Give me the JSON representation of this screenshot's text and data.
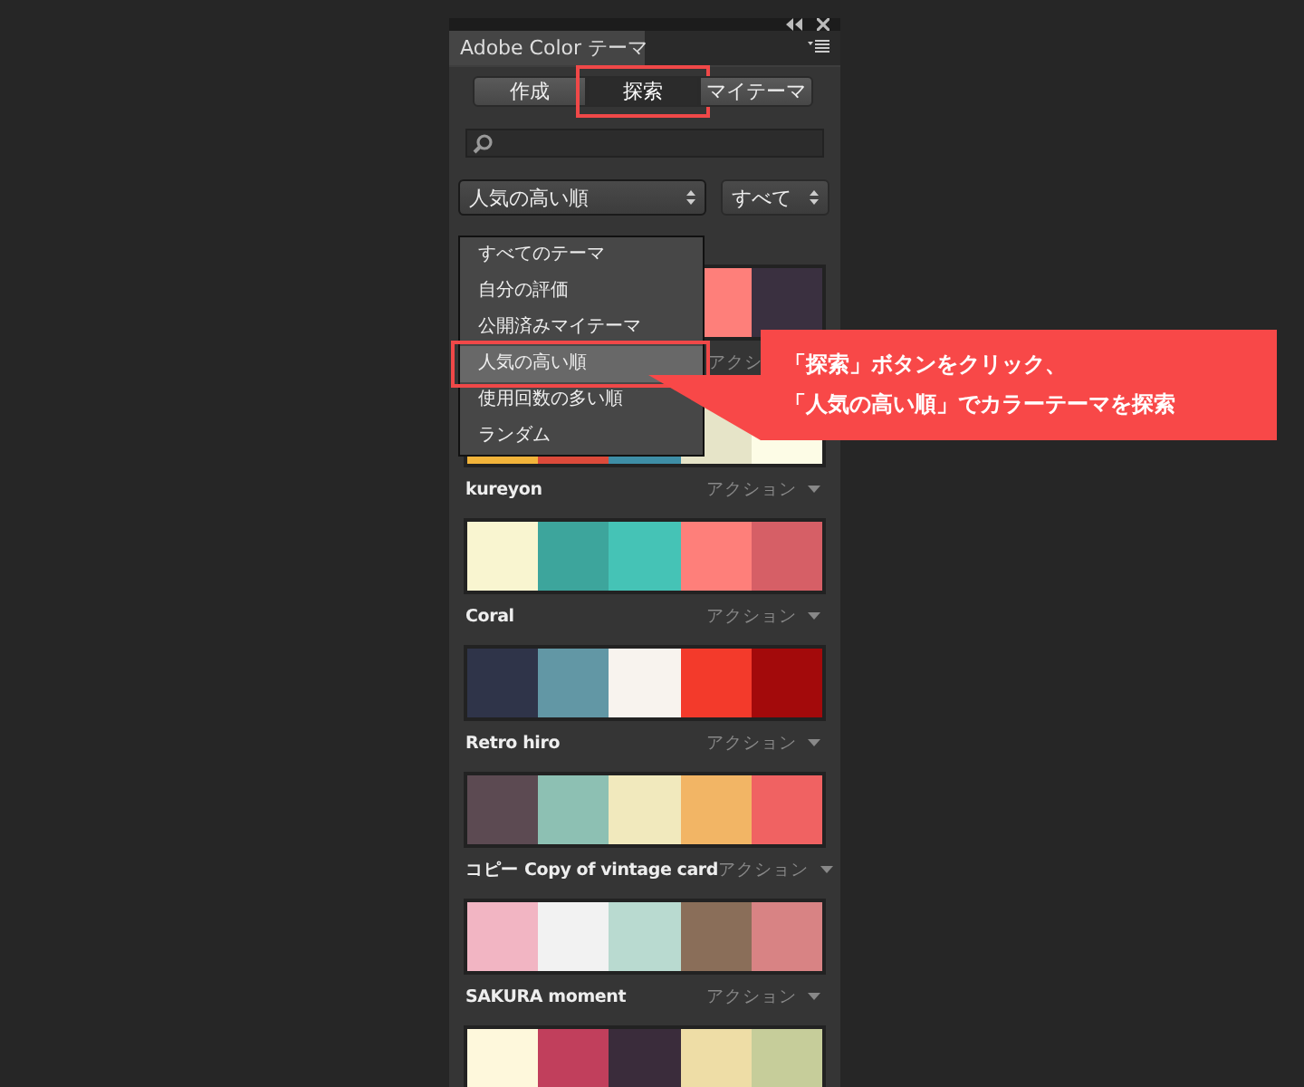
{
  "panel": {
    "title": "Adobe Color テーマ"
  },
  "modes": [
    {
      "label": "作成",
      "selected": false
    },
    {
      "label": "探索",
      "selected": true,
      "highlighted": true
    },
    {
      "label": "マイテーマ",
      "selected": false
    }
  ],
  "sort": {
    "value": "人気の高い順",
    "expanded": true,
    "options": [
      {
        "label": "すべてのテーマ",
        "selected": false
      },
      {
        "label": "自分の評価",
        "selected": false
      },
      {
        "label": "公開済みマイテーマ",
        "selected": false
      },
      {
        "label": "人気の高い順",
        "selected": true,
        "highlighted": true
      },
      {
        "label": "使用回数の多い順",
        "selected": false
      },
      {
        "label": "ランダム",
        "selected": false
      }
    ]
  },
  "filter": {
    "value": "すべて"
  },
  "themes": [
    {
      "action": "アクシ",
      "swatches": [
        {
          "color": "#fe7f7a"
        },
        {
          "color": "#3a3040"
        }
      ]
    },
    {
      "name": "kureyon",
      "action": "アクション",
      "swatches": [
        {
          "color": "#f2b43a"
        },
        {
          "color": "#dc4a3a"
        },
        {
          "color": "#3e8ea6"
        },
        {
          "color": "#e6e4c8"
        },
        {
          "color": "#fdfce6"
        }
      ]
    },
    {
      "name": "Coral",
      "action": "アクション",
      "swatches": [
        {
          "color": "#f9f5d0"
        },
        {
          "color": "#3da59c"
        },
        {
          "color": "#45c3b6"
        },
        {
          "color": "#fe7f7a"
        },
        {
          "color": "#d65f66"
        }
      ]
    },
    {
      "name": "Retro hiro",
      "action": "アクション",
      "swatches": [
        {
          "color": "#2f3449"
        },
        {
          "color": "#6297a5"
        },
        {
          "color": "#f8f3ee"
        },
        {
          "color": "#f33a2b"
        },
        {
          "color": "#a30a0b"
        }
      ]
    },
    {
      "name": "コピー Copy of vintage card",
      "action": "アクション",
      "swatches": [
        {
          "color": "#5c4a52"
        },
        {
          "color": "#8dc0b3"
        },
        {
          "color": "#f1e9bd"
        },
        {
          "color": "#f2b565"
        },
        {
          "color": "#f06262"
        }
      ]
    },
    {
      "name": "SAKURA moment",
      "action": "アクション",
      "swatches": [
        {
          "color": "#f2b5c3"
        },
        {
          "color": "#f2f2f2"
        },
        {
          "color": "#b9dad0"
        },
        {
          "color": "#8a6e59"
        },
        {
          "color": "#d88384"
        }
      ]
    },
    {
      "swatches": [
        {
          "color": "#fef8dc"
        },
        {
          "color": "#c13f5c"
        },
        {
          "color": "#3a2c3b"
        },
        {
          "color": "#eedda6"
        },
        {
          "color": "#c6cd9a"
        }
      ]
    }
  ],
  "callout": {
    "lines": [
      "「探索」ボタンをクリック、",
      "「人気の高い順」でカラーテーマを探索"
    ]
  }
}
